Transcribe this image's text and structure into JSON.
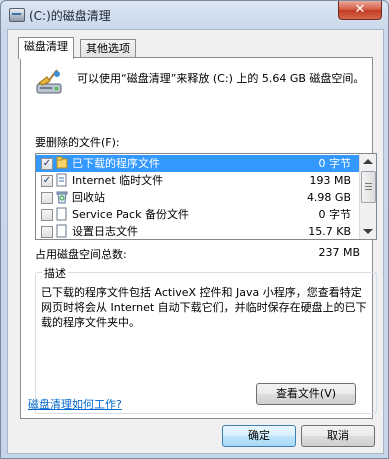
{
  "window": {
    "title": "(C:)的磁盘清理",
    "close_glyph": "✕"
  },
  "tabs": [
    {
      "label": "磁盘清理"
    },
    {
      "label": "其他选项"
    }
  ],
  "summary": {
    "text": "可以使用“磁盘清理”来释放 (C:) 上的 5.64 GB 磁盘空间。"
  },
  "files": {
    "label": "要删除的文件(F):",
    "items": [
      {
        "name": "已下载的程序文件",
        "size": "0 字节",
        "checked": true,
        "selected": true,
        "icon": "folder-icon"
      },
      {
        "name": "Internet 临时文件",
        "size": "193 MB",
        "checked": true,
        "selected": false,
        "icon": "document-icon"
      },
      {
        "name": "回收站",
        "size": "4.98 GB",
        "checked": false,
        "selected": false,
        "icon": "recycle-bin-icon"
      },
      {
        "name": "Service Pack 备份文件",
        "size": "0 字节",
        "checked": false,
        "selected": false,
        "icon": "document-icon"
      },
      {
        "name": "设置日志文件",
        "size": "15.7 KB",
        "checked": false,
        "selected": false,
        "icon": "document-icon"
      }
    ]
  },
  "total": {
    "label": "占用磁盘空间总数:",
    "value": "237 MB"
  },
  "description": {
    "label": "描述",
    "text": "已下载的程序文件包括 ActiveX 控件和 Java 小程序，您查看特定网页时将会从 Internet 自动下载它们，并临时保存在硬盘上的已下载的程序文件夹中。",
    "view_files_button": "查看文件(V)"
  },
  "help_link": "磁盘清理如何工作?",
  "buttons": {
    "ok": "确定",
    "cancel": "取消"
  },
  "colors": {
    "selection": "#3399ff",
    "link": "#0066cc"
  }
}
